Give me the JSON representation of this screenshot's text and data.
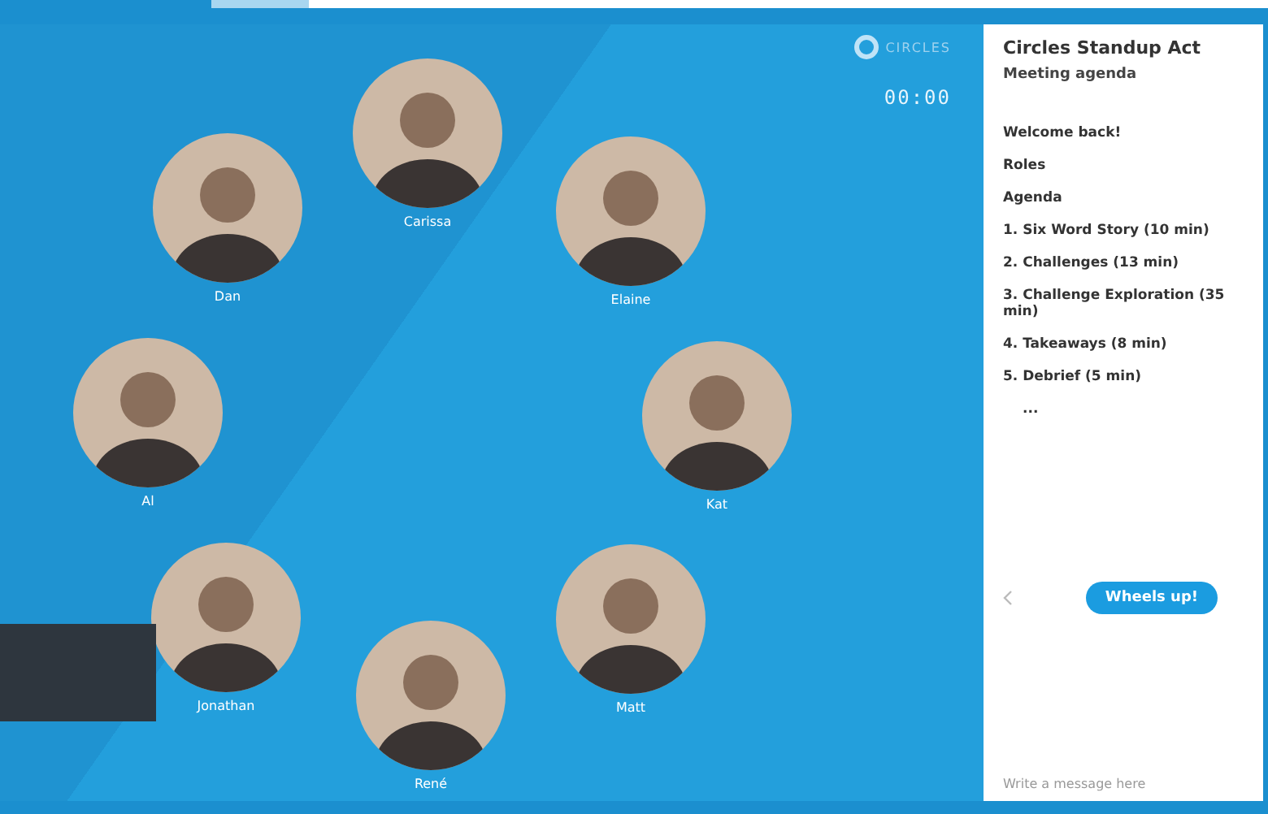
{
  "brand": {
    "name": "CIRCLES"
  },
  "timer": "00:00",
  "participants": [
    {
      "name": "Carissa"
    },
    {
      "name": "Dan"
    },
    {
      "name": "Elaine"
    },
    {
      "name": "Al"
    },
    {
      "name": "Kat"
    },
    {
      "name": "Jonathan"
    },
    {
      "name": "Matt"
    },
    {
      "name": "René"
    }
  ],
  "sidebar": {
    "title": "Circles Standup Act",
    "subtitle": "Meeting agenda",
    "agenda": [
      "Welcome back!",
      "Roles",
      "Agenda",
      "1. Six Word Story (10 min)",
      "2. Challenges (13 min)",
      "3. Challenge Exploration (35 min)",
      "4. Takeaways (8 min)",
      "5. Debrief (5 min)",
      "..."
    ],
    "action_button": "Wheels up!",
    "message": {
      "placeholder": "Write a message here"
    }
  }
}
